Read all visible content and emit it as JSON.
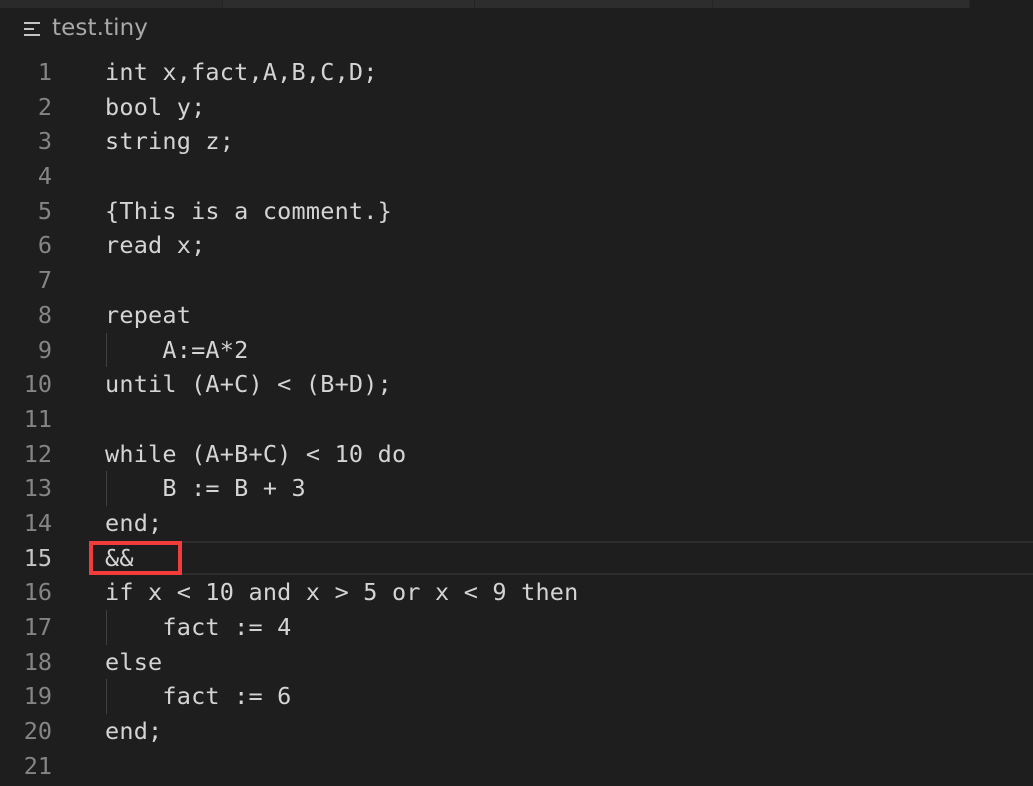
{
  "tabs": [
    {
      "label": ""
    },
    {
      "label": ""
    },
    {
      "label": ""
    },
    {
      "label": ""
    }
  ],
  "breadcrumb": {
    "icon": "plain-text-file-icon",
    "file_name": "test.tiny"
  },
  "editor": {
    "current_line": 15,
    "lines": [
      {
        "number": "1",
        "text": "int x,fact,A,B,C,D;",
        "indent_guide": false
      },
      {
        "number": "2",
        "text": "bool y;",
        "indent_guide": false
      },
      {
        "number": "3",
        "text": "string z;",
        "indent_guide": false
      },
      {
        "number": "4",
        "text": "",
        "indent_guide": false
      },
      {
        "number": "5",
        "text": "{This is a comment.}",
        "indent_guide": false
      },
      {
        "number": "6",
        "text": "read x;",
        "indent_guide": false
      },
      {
        "number": "7",
        "text": "",
        "indent_guide": false
      },
      {
        "number": "8",
        "text": "repeat",
        "indent_guide": false
      },
      {
        "number": "9",
        "text": "    A:=A*2",
        "indent_guide": true
      },
      {
        "number": "10",
        "text": "until (A+C) < (B+D);",
        "indent_guide": false
      },
      {
        "number": "11",
        "text": "",
        "indent_guide": false
      },
      {
        "number": "12",
        "text": "while (A+B+C) < 10 do",
        "indent_guide": false
      },
      {
        "number": "13",
        "text": "    B := B + 3",
        "indent_guide": true
      },
      {
        "number": "14",
        "text": "end;",
        "indent_guide": false
      },
      {
        "number": "15",
        "text": "&&",
        "indent_guide": false
      },
      {
        "number": "16",
        "text": "if x < 10 and x > 5 or x < 9 then",
        "indent_guide": false
      },
      {
        "number": "17",
        "text": "    fact := 4",
        "indent_guide": true
      },
      {
        "number": "18",
        "text": "else",
        "indent_guide": false
      },
      {
        "number": "19",
        "text": "    fact := 6",
        "indent_guide": true
      },
      {
        "number": "20",
        "text": "end;",
        "indent_guide": false
      },
      {
        "number": "21",
        "text": "",
        "indent_guide": false
      }
    ]
  },
  "annotation": {
    "label": "highlight-box",
    "target_line": 15,
    "color": "#f23b3b"
  },
  "colors": {
    "background": "#1e1e1e",
    "text": "#d4d4d4",
    "line_number": "#858585",
    "line_number_active": "#c6c6c6"
  }
}
